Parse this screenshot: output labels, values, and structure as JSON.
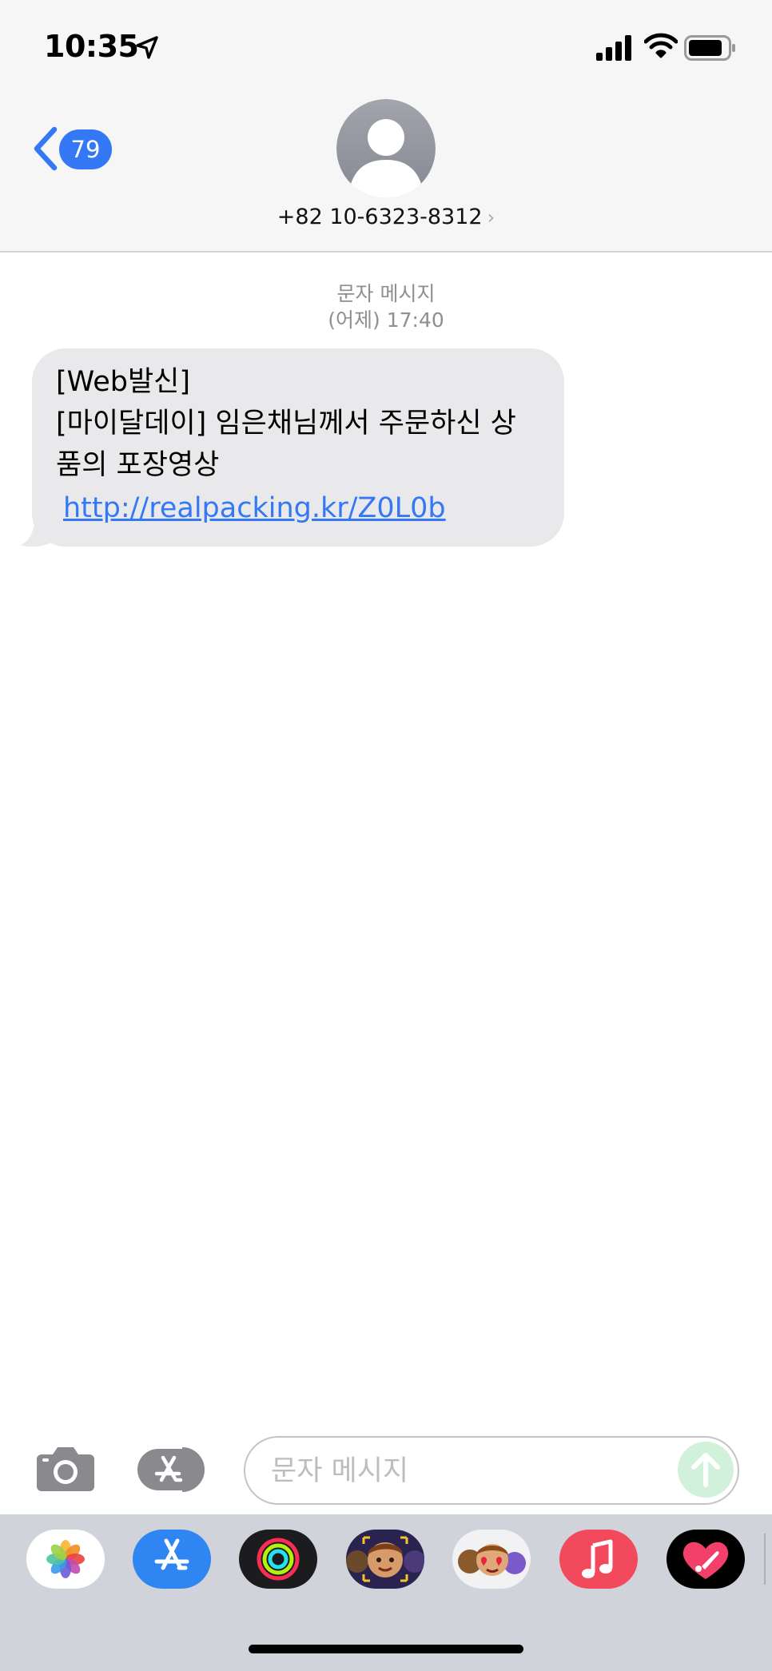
{
  "status_bar": {
    "time": "10:35"
  },
  "header": {
    "back_badge": "79",
    "contact_number": "+82 10-6323-8312",
    "contact_chevron": "›"
  },
  "conversation": {
    "service_label": "문자 메시지",
    "timestamp": "(어제) 17:40",
    "message": {
      "line1": "[Web발신]",
      "line2": "[마이달데이] 임은채님께서 주문하신 상",
      "line3": "품의 포장영상",
      "link": "http://realpacking.kr/Z0L0b"
    }
  },
  "compose": {
    "placeholder": "문자 메시지"
  },
  "app_drawer": {
    "apps": [
      "photos-icon",
      "app-store-icon",
      "activity-icon",
      "memoji-icon",
      "animoji-stickers-icon",
      "music-icon",
      "digital-touch-icon"
    ]
  },
  "colors": {
    "accent": "#3478f6",
    "bubble": "#e9e9eb",
    "send_disabled": "#d2f1da",
    "header_bg": "#f6f6f6",
    "drawer_bg": "#d1d3da"
  }
}
